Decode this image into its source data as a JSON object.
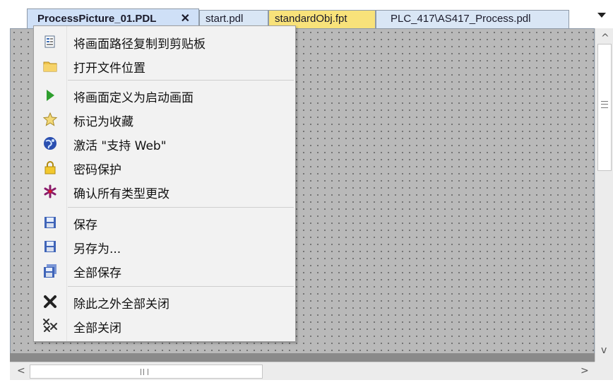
{
  "tabs": [
    {
      "label": "ProcessPicture_01.PDL",
      "close": "✕"
    },
    {
      "label": "start.pdl"
    },
    {
      "label": "standardObj.fpt"
    },
    {
      "label": "PLC_417\\AS417_Process.pdl"
    }
  ],
  "menu": {
    "items": [
      {
        "label": "将画面路径复制到剪贴板",
        "icon": "clipboard-icon"
      },
      {
        "label": "打开文件位置",
        "icon": "folder-icon"
      },
      {
        "label": "将画面定义为启动画面",
        "icon": "play-icon"
      },
      {
        "label": "标记为收藏",
        "icon": "star-icon"
      },
      {
        "label": "激活 \"支持 Web\"",
        "icon": "globe-icon"
      },
      {
        "label": "密码保护",
        "icon": "lock-icon"
      },
      {
        "label": "确认所有类型更改",
        "icon": "asterisk-icon"
      },
      {
        "label": "保存",
        "icon": "save-icon"
      },
      {
        "label": "另存为...",
        "icon": "save-as-icon"
      },
      {
        "label": "全部保存",
        "icon": "save-all-icon"
      },
      {
        "label": "除此之外全部关闭",
        "icon": "close-others-icon"
      },
      {
        "label": "全部关闭",
        "icon": "close-all-icon"
      }
    ]
  },
  "scrollbar": {
    "up": "^",
    "down": "v",
    "left": "<",
    "right": ">"
  },
  "colors": {
    "active_tab": "#cfe0f7",
    "highlight_tab": "#f8e27a",
    "canvas": "#b9b9b9"
  }
}
